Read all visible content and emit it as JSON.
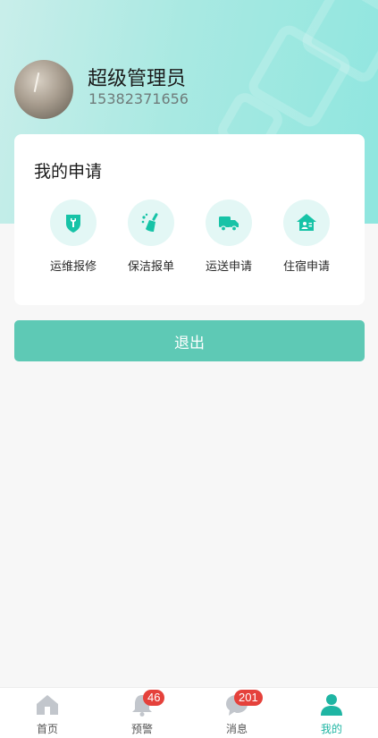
{
  "profile": {
    "name": "超级管理员",
    "phone": "15382371656"
  },
  "applications": {
    "title": "我的申请",
    "items": [
      {
        "label": "运维报修",
        "icon": "wrench-shield-icon"
      },
      {
        "label": "保洁报单",
        "icon": "broom-icon"
      },
      {
        "label": "运送申请",
        "icon": "truck-icon"
      },
      {
        "label": "住宿申请",
        "icon": "house-icon"
      }
    ]
  },
  "logout_label": "退出",
  "tabbar": {
    "items": [
      {
        "label": "首页",
        "icon": "home-icon"
      },
      {
        "label": "预警",
        "icon": "bell-icon",
        "badge": "46"
      },
      {
        "label": "消息",
        "icon": "chat-icon",
        "badge": "201"
      },
      {
        "label": "我的",
        "icon": "user-icon",
        "active": true
      }
    ]
  },
  "colors": {
    "accent": "#1fb5a3",
    "button": "#5ec9b5",
    "badge": "#e5413b",
    "icon_bg": "#e3f7f5"
  }
}
